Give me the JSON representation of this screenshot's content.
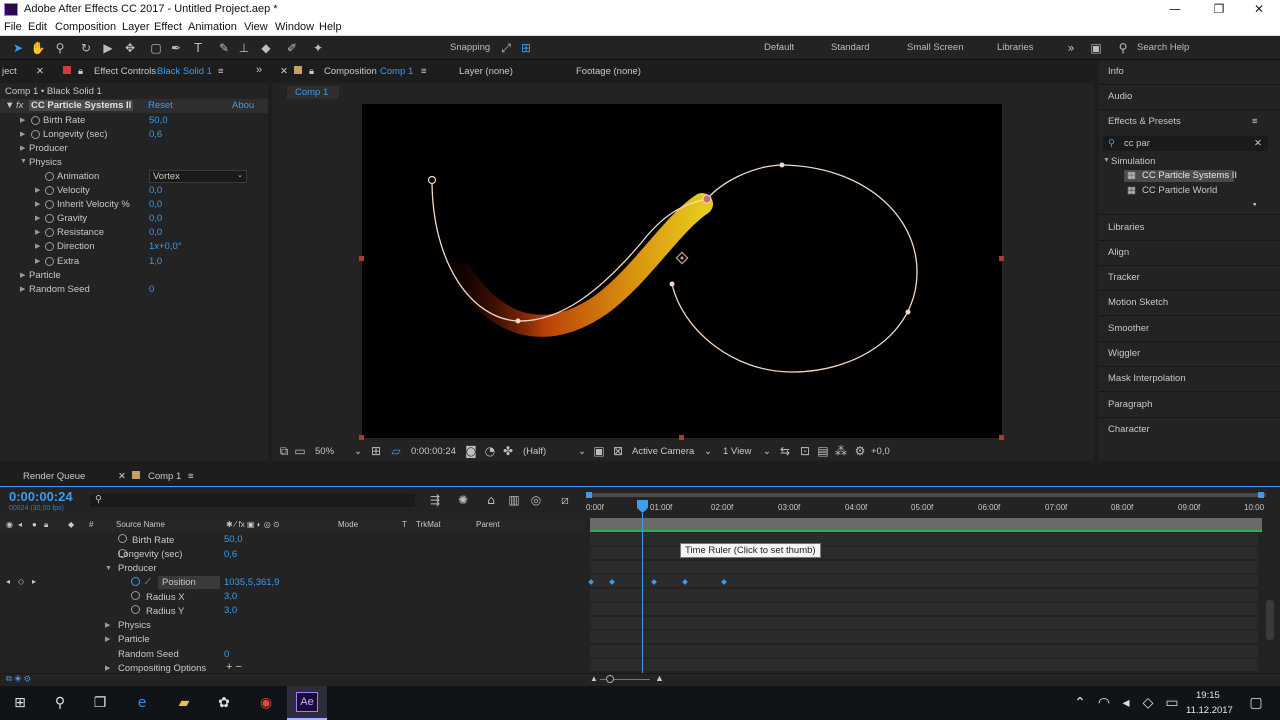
{
  "window": {
    "title": "Adobe After Effects CC 2017 - Untitled Project.aep *",
    "controls": {
      "minimize": "—",
      "maximize": "❐",
      "close": "✕"
    }
  },
  "menu": [
    "File",
    "Edit",
    "Composition",
    "Layer",
    "Effect",
    "Animation",
    "View",
    "Window",
    "Help"
  ],
  "toolbar": {
    "snapping": "Snapping",
    "workspaces": [
      "Default",
      "Standard",
      "Small Screen",
      "Libraries"
    ],
    "search_help": "Search Help"
  },
  "effect_panel": {
    "project_tab": "ject",
    "tab_label": "Effect Controls",
    "tab_layer": "Black Solid 1",
    "breadcrumb": "Comp 1 • Black Solid 1",
    "effect_name": "CC Particle Systems II",
    "reset": "Reset",
    "about": "Abou",
    "props": [
      {
        "label": "Birth Rate",
        "value": "50,0"
      },
      {
        "label": "Longevity (sec)",
        "value": "0,6"
      },
      {
        "label": "Producer",
        "value": ""
      },
      {
        "label": "Physics",
        "value": ""
      },
      {
        "label": "Animation",
        "value": "Vortex"
      },
      {
        "label": "Velocity",
        "value": "0,0"
      },
      {
        "label": "Inherit Velocity %",
        "value": "0,0"
      },
      {
        "label": "Gravity",
        "value": "0,0"
      },
      {
        "label": "Resistance",
        "value": "0,0"
      },
      {
        "label": "Direction",
        "value": "1x+0,0°"
      },
      {
        "label": "Extra",
        "value": "1,0"
      },
      {
        "label": "Particle",
        "value": ""
      },
      {
        "label": "Random Seed",
        "value": "0"
      }
    ]
  },
  "viewer": {
    "comp_tab": "Composition",
    "comp_name": "Comp 1",
    "layer_tab": "Layer (none)",
    "footage_tab": "Footage (none)",
    "comp_chip": "Comp 1",
    "zoom": "50%",
    "timecode": "0:00:00:24",
    "resolution": "(Half)",
    "camera": "Active Camera",
    "views": "1 View",
    "exposure": "+0,0"
  },
  "right_panel": {
    "info": "Info",
    "audio": "Audio",
    "effects_presets": "Effects & Presets",
    "search_value": "cc par",
    "category": "Simulation",
    "results": [
      "CC Particle Systems II",
      "CC Particle World"
    ],
    "panels": [
      "Libraries",
      "Align",
      "Tracker",
      "Motion Sketch",
      "Smoother",
      "Wiggler",
      "Mask Interpolation",
      "Paragraph",
      "Character"
    ]
  },
  "timeline": {
    "render_queue": "Render Queue",
    "comp_tab": "Comp 1",
    "current_time": "0:00:00:24",
    "frame_info": "00024 (30,00 fps)",
    "columns": {
      "source_name": "Source Name",
      "mode": "Mode",
      "t": "T",
      "trkmat": "TrkMat",
      "parent": "Parent",
      "num": "#"
    },
    "ruler": [
      "0:00f",
      "01:00f",
      "02:00f",
      "03:00f",
      "04:00f",
      "05:00f",
      "06:00f",
      "07:00f",
      "08:00f",
      "09:00f",
      "10:00"
    ],
    "rows": [
      {
        "label": "Birth Rate",
        "value": "50,0"
      },
      {
        "label": "Longevity (sec)",
        "value": "0,6"
      },
      {
        "label": "Producer",
        "value": ""
      },
      {
        "label": "Position",
        "value": "1035,5,361,9"
      },
      {
        "label": "Radius X",
        "value": "3,0"
      },
      {
        "label": "Radius Y",
        "value": "3,0"
      },
      {
        "label": "Physics",
        "value": ""
      },
      {
        "label": "Particle",
        "value": ""
      },
      {
        "label": "Random Seed",
        "value": "0"
      },
      {
        "label": "Compositing Options",
        "value": ""
      }
    ],
    "tooltip": "Time Ruler (Click to set thumb)"
  },
  "taskbar": {
    "time": "19:15",
    "date": "11.12.2017",
    "ae_label": "Ae"
  },
  "colors": {
    "accent": "#3b9cf0",
    "panel": "#232323",
    "background": "#1d1d1d"
  }
}
